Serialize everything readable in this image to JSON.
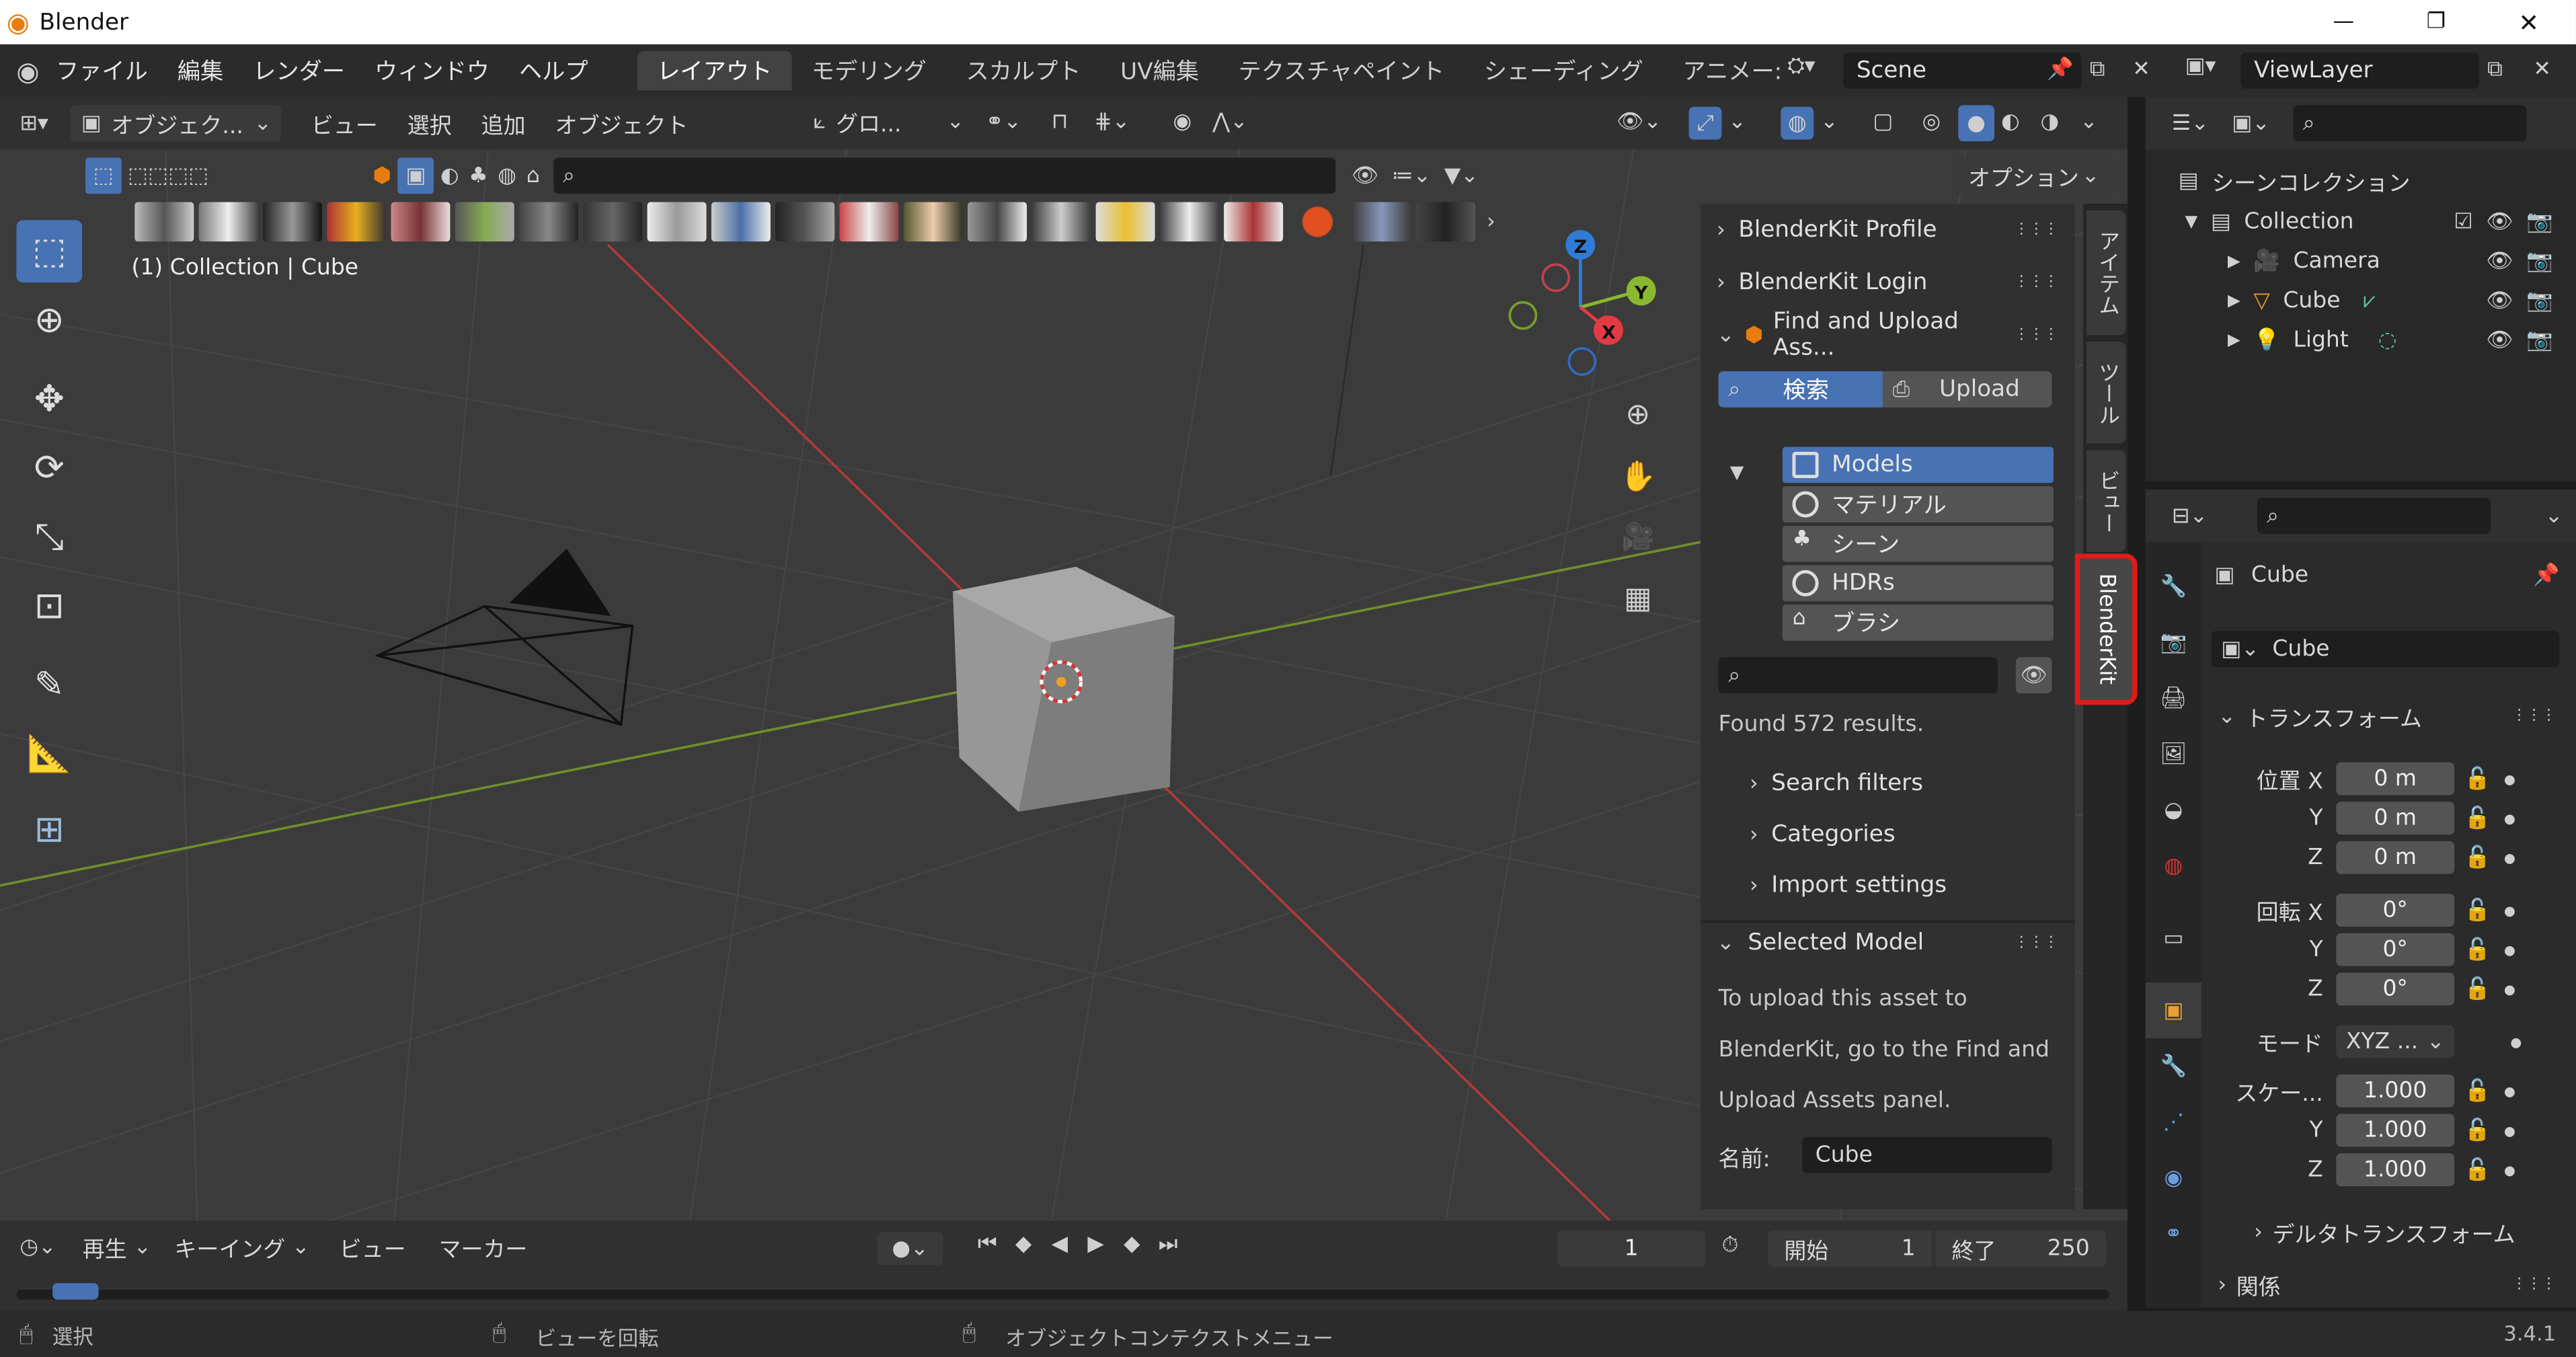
{
  "window": {
    "title": "Blender"
  },
  "menubar": {
    "items": [
      "ファイル",
      "編集",
      "レンダー",
      "ウィンドウ",
      "ヘルプ"
    ],
    "workspaces": [
      "レイアウト",
      "モデリング",
      "スカルプト",
      "UV編集",
      "テクスチャペイント",
      "シェーディング",
      "アニメー:"
    ],
    "scene": "Scene",
    "viewlayer": "ViewLayer"
  },
  "vpheader": {
    "mode": "オブジェク...",
    "menus": [
      "ビュー",
      "選択",
      "追加",
      "オブジェクト"
    ],
    "orientation": "グロ...",
    "options": "オプション"
  },
  "viewport": {
    "info": "(1) Collection | Cube"
  },
  "blenderkit": {
    "profile": "BlenderKit Profile",
    "login": "BlenderKit Login",
    "find": "Find and Upload Ass...",
    "search_tab": "検索",
    "upload_tab": "Upload",
    "categories": [
      "Models",
      "マテリアル",
      "シーン",
      "HDRs",
      "ブラシ"
    ],
    "found": "Found 572 results.",
    "sections": [
      "Search filters",
      "Categories",
      "Import settings"
    ],
    "selected_model": "Selected Model",
    "upload_note": [
      "To upload this asset to",
      "BlenderKit, go to the Find and",
      "Upload Assets panel."
    ],
    "name_label": "名前:",
    "name_value": "Cube"
  },
  "vtabs": [
    "アイテム",
    "ツール",
    "ビュー",
    "BlenderKit"
  ],
  "outliner": {
    "root": "シーンコレクション",
    "collection": "Collection",
    "items": [
      "Camera",
      "Cube",
      "Light"
    ]
  },
  "properties": {
    "object": "Cube",
    "data": "Cube",
    "transform": "トランスフォーム",
    "location_label": "位置 X",
    "rotation_label": "回転 X",
    "mode_label": "モード",
    "mode_value": "XYZ ...",
    "scale_label": "スケー...",
    "y": "Y",
    "z": "Z",
    "location": [
      "0 m",
      "0 m",
      "0 m"
    ],
    "rotation": [
      "0°",
      "0°",
      "0°"
    ],
    "scale": [
      "1.000",
      "1.000",
      "1.000"
    ],
    "delta": "デルタトランスフォーム",
    "relations": "関係"
  },
  "timeline": {
    "menus": [
      "再生",
      "キーイング",
      "ビュー",
      "マーカー"
    ],
    "current_frame": "1",
    "start_label": "開始",
    "start": "1",
    "end_label": "終了",
    "end": "250"
  },
  "statusbar": {
    "select": "選択",
    "rotate": "ビューを回転",
    "context": "オブジェクトコンテクストメニュー",
    "version": "3.4.1"
  },
  "colors": {
    "accent": "#4772b3",
    "highlight_box": "#e01b1b",
    "x_axis": "#e23a44",
    "y_axis": "#8ab82f",
    "z_axis": "#2f7bd6"
  }
}
